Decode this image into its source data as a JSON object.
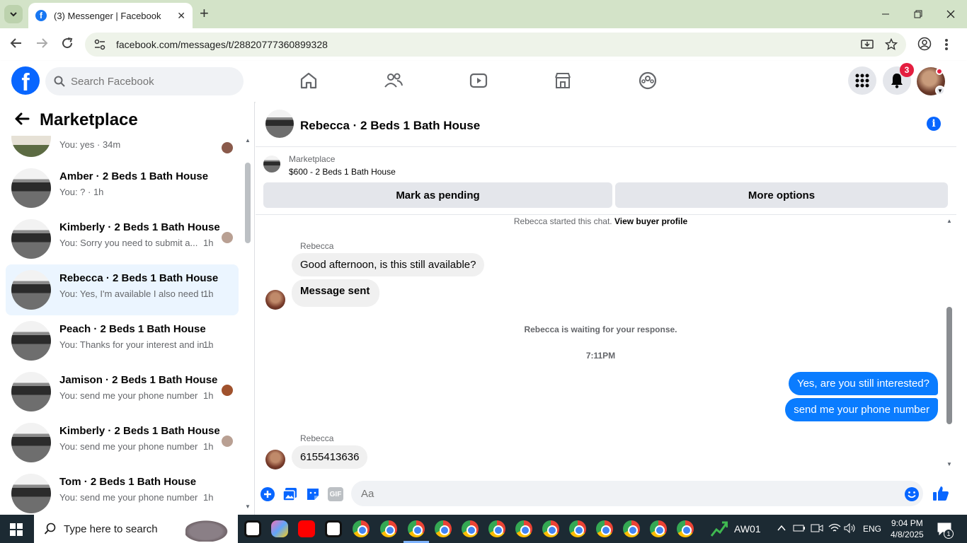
{
  "browser": {
    "tab_title": "(3) Messenger | Facebook",
    "url": "facebook.com/messages/t/28820777360899328",
    "new_tab_symbol": "+",
    "close_symbol": "✕"
  },
  "fb_header": {
    "search_placeholder": "Search Facebook",
    "notification_count": "3"
  },
  "left_panel": {
    "title": "Marketplace",
    "conversations": [
      {
        "name": "",
        "preview": "You: yes · 34m",
        "time": ""
      },
      {
        "name": "Amber · 2 Beds 1 Bath House",
        "preview": "You: ? · 1h",
        "time": ""
      },
      {
        "name": "Kimberly · 2 Beds 1 Bath House",
        "preview": "You: Sorry you need to submit a...",
        "time": "1h"
      },
      {
        "name": "Rebecca · 2 Beds 1 Bath House",
        "preview": "You: Yes, I'm available I also need t...",
        "time": "1h"
      },
      {
        "name": "Peach · 2 Beds 1 Bath House",
        "preview": "You: Thanks for your interest and in...",
        "time": "1h"
      },
      {
        "name": "Jamison · 2 Beds 1 Bath House",
        "preview": "You: send me your phone number",
        "time": "1h"
      },
      {
        "name": "Kimberly · 2 Beds 1 Bath House",
        "preview": "You: send me your phone number",
        "time": "1h"
      },
      {
        "name": "Tom · 2 Beds 1 Bath House",
        "preview": "You: send me your phone number",
        "time": "1h"
      }
    ]
  },
  "chat": {
    "title": "Rebecca · 2 Beds 1 Bath House",
    "listing_source": "Marketplace",
    "listing_price": "$600 - 2 Beds 1 Bath House",
    "mark_pending_label": "Mark as pending",
    "more_options_label": "More options",
    "started_text": "Rebecca started this chat.",
    "view_profile_link": "View buyer profile",
    "sender": "Rebecca",
    "msg1": "Good afternoon, is this still available?",
    "msg2": "Message sent",
    "waiting_text": "Rebecca is waiting for your response.",
    "timestamp": "7:11PM",
    "out1": "Yes, are you still interested?",
    "out2": "send me your phone number",
    "msg3": "6155413636",
    "input_placeholder": "Aa",
    "gif_label": "GIF"
  },
  "taskbar": {
    "search_placeholder": "Type here to search",
    "tray_label": "AW01",
    "language": "ENG",
    "time": "9:04 PM",
    "date": "4/8/2025",
    "notification_badge": "1"
  },
  "colors": {
    "fb_blue": "#0866ff",
    "messenger_blue": "#0a7cff",
    "notification_red": "#e41e3f",
    "chrome_tabbar": "#d3e3c8"
  }
}
